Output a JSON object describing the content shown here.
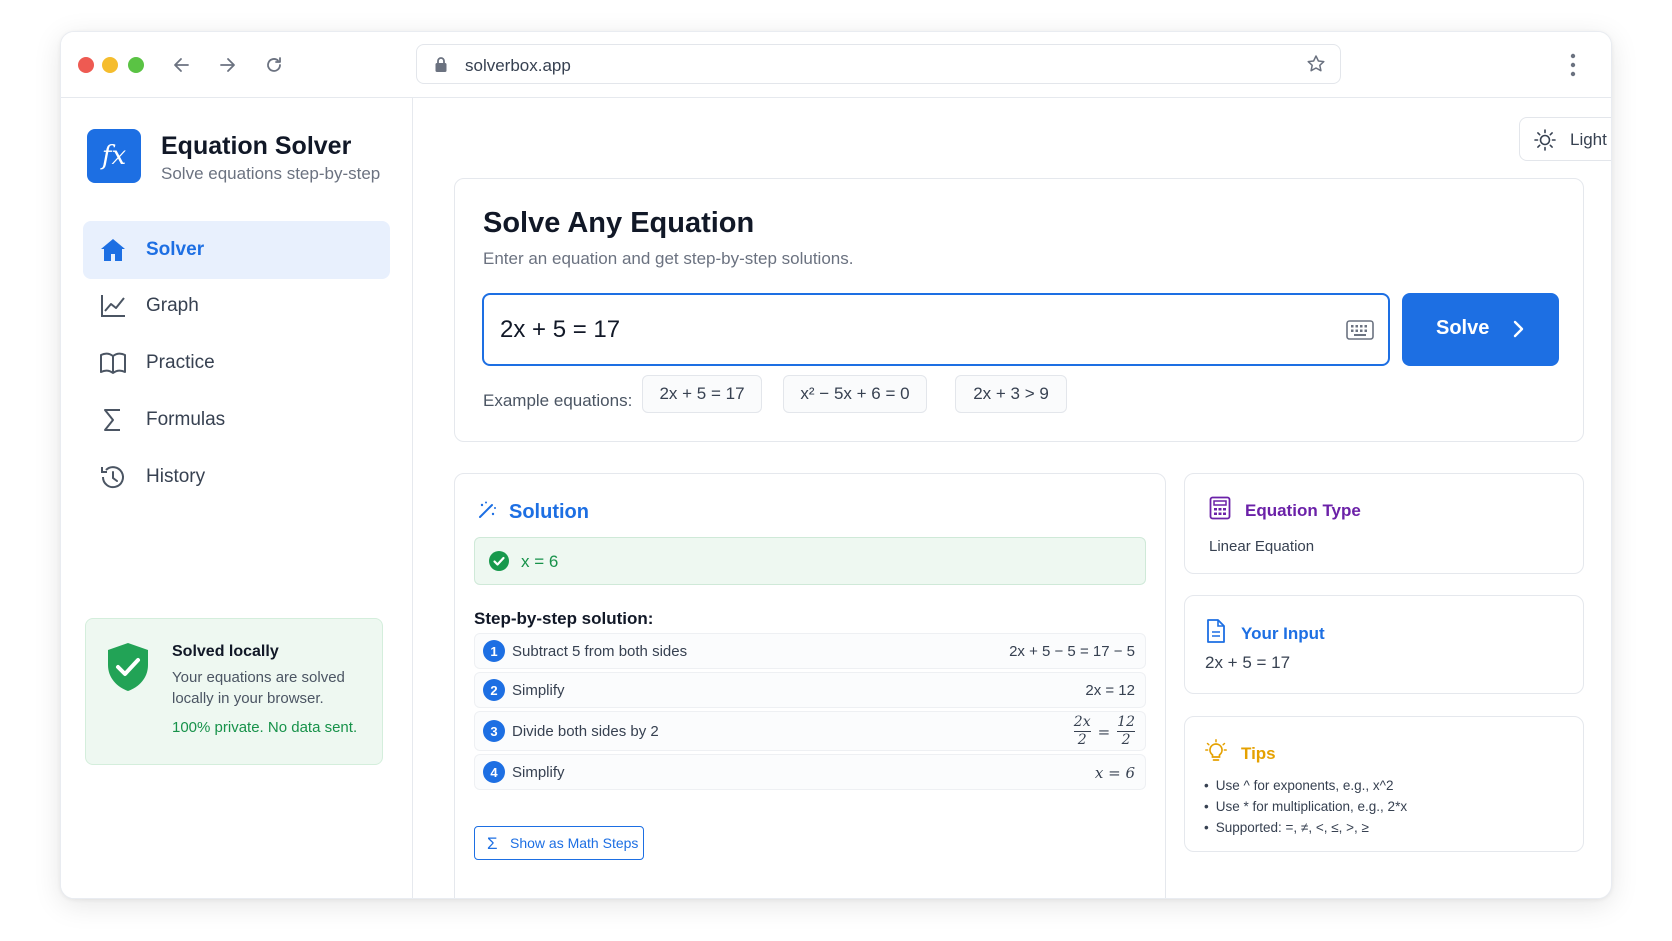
{
  "browser": {
    "url": "solverbox.app",
    "icons": [
      "back-arrow-icon",
      "forward-arrow-icon",
      "reload-icon",
      "lock-icon",
      "star-icon",
      "kebab-menu-icon"
    ]
  },
  "app": {
    "logo_text": "fx",
    "title": "Equation Solver",
    "subtitle": "Solve equations step-by-step"
  },
  "sidebar": {
    "items": [
      {
        "label": "Solver",
        "icon": "home-icon",
        "active": true
      },
      {
        "label": "Graph",
        "icon": "line-chart-icon",
        "active": false
      },
      {
        "label": "Practice",
        "icon": "book-icon",
        "active": false
      },
      {
        "label": "Formulas",
        "icon": "sigma-icon",
        "active": false
      },
      {
        "label": "History",
        "icon": "history-icon",
        "active": false
      }
    ],
    "local_card": {
      "title": "Solved locally",
      "text": "Your equations are solved locally in your browser.",
      "note": "100% private. No data sent.",
      "icon": "shield-check-icon"
    }
  },
  "theme": {
    "label": "Light",
    "icon": "sun-icon"
  },
  "solver": {
    "title": "Solve Any Equation",
    "subtitle": "Enter an equation and get step-by-step solutions.",
    "input_value": "2x + 5 = 17",
    "solve_label": "Solve",
    "examples_label": "Example equations:",
    "examples": [
      "2x + 5 = 17",
      "x² − 5x + 6 = 0",
      "2x + 3 > 9"
    ]
  },
  "solution": {
    "title": "Solution",
    "answer": "x = 6",
    "steps_title": "Step-by-step solution:",
    "steps": [
      {
        "num": "1",
        "label": "Subtract 5 from both sides",
        "expr": "2x + 5 − 5 = 17 − 5"
      },
      {
        "num": "2",
        "label": "Simplify",
        "expr": "2x = 12"
      },
      {
        "num": "3",
        "label": "Divide both sides by 2",
        "expr_num_left": "2x",
        "expr_den_left": "2",
        "expr_eq": "=",
        "expr_num_right": "12",
        "expr_den_right": "2"
      },
      {
        "num": "4",
        "label": "Simplify",
        "expr": "x = 6"
      }
    ],
    "math_steps_label": "Show as Math Steps"
  },
  "equation_type": {
    "title": "Equation Type",
    "value": "Linear Equation",
    "color": "#6b21a8"
  },
  "your_input": {
    "title": "Your Input",
    "value": "2x + 5 = 17",
    "color": "#1d6fe3"
  },
  "tips": {
    "title": "Tips",
    "color": "#e5a100",
    "items": [
      "Use ^ for exponents, e.g., x^2",
      "Use * for multiplication, e.g., 2*x",
      "Supported: =, ≠, <, ≤, >, ≥"
    ]
  },
  "colors": {
    "accent": "#1d6fe3",
    "success": "#17924a"
  }
}
